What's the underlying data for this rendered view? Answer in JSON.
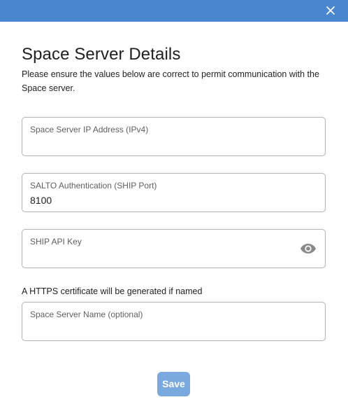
{
  "window": {
    "close_icon": "close-icon",
    "accent_color": "#4a86d0"
  },
  "dialog": {
    "title": "Space Server Details",
    "description": "Please ensure the values below are correct to permit communication with the Space server."
  },
  "fields": {
    "ip": {
      "label": "Space Server IP Address (IPv4)",
      "value": ""
    },
    "port": {
      "label": "SALTO Authentication (SHIP Port)",
      "value": "8100"
    },
    "api_key": {
      "label": "SHIP API Key",
      "value": "",
      "toggle_icon": "eye-icon"
    },
    "certificate_note": "A HTTPS certificate will be generated if named",
    "server_name": {
      "label": "Space Server Name (optional)",
      "value": ""
    }
  },
  "actions": {
    "save_label": "Save",
    "save_color": "#7aa9e0"
  }
}
